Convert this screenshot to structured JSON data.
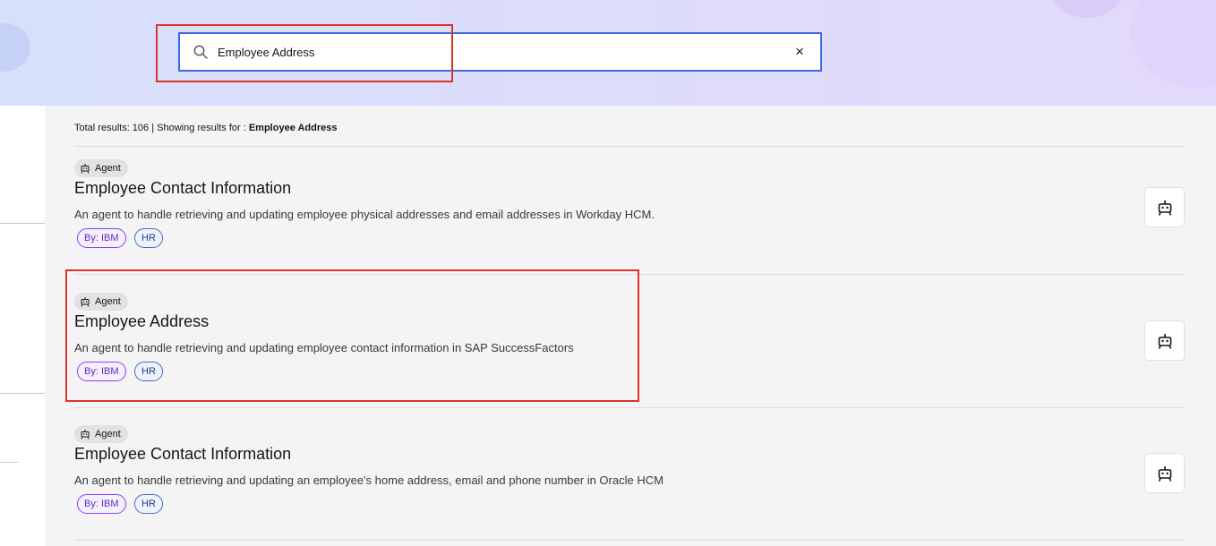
{
  "search": {
    "value": "Employee Address"
  },
  "results_summary": {
    "prefix": "Total results: 106 | Showing results for :",
    "query": "Employee Address"
  },
  "results": [
    {
      "type": "Agent",
      "title": "Employee Contact Information",
      "description": "An agent to handle retrieving and updating employee physical addresses and email addresses in Workday HCM.",
      "tags": [
        "By: IBM",
        "HR"
      ]
    },
    {
      "type": "Agent",
      "title": "Employee Address",
      "description": "An agent to handle retrieving and updating employee contact information in SAP SuccessFactors",
      "tags": [
        "By: IBM",
        "HR"
      ]
    },
    {
      "type": "Agent",
      "title": "Employee Contact Information",
      "description": "An agent to handle retrieving and updating an employee's home address, email and phone number in Oracle HCM",
      "tags": [
        "By: IBM",
        "HR"
      ]
    }
  ],
  "icons": {
    "search": "search-icon",
    "clear": "close-icon",
    "agent": "robot-icon"
  },
  "colors": {
    "search_border": "#3f68e0",
    "annotation": "#d9352a",
    "tag_by": "#8a3ffc",
    "tag_hr": "#4c6bc2"
  }
}
